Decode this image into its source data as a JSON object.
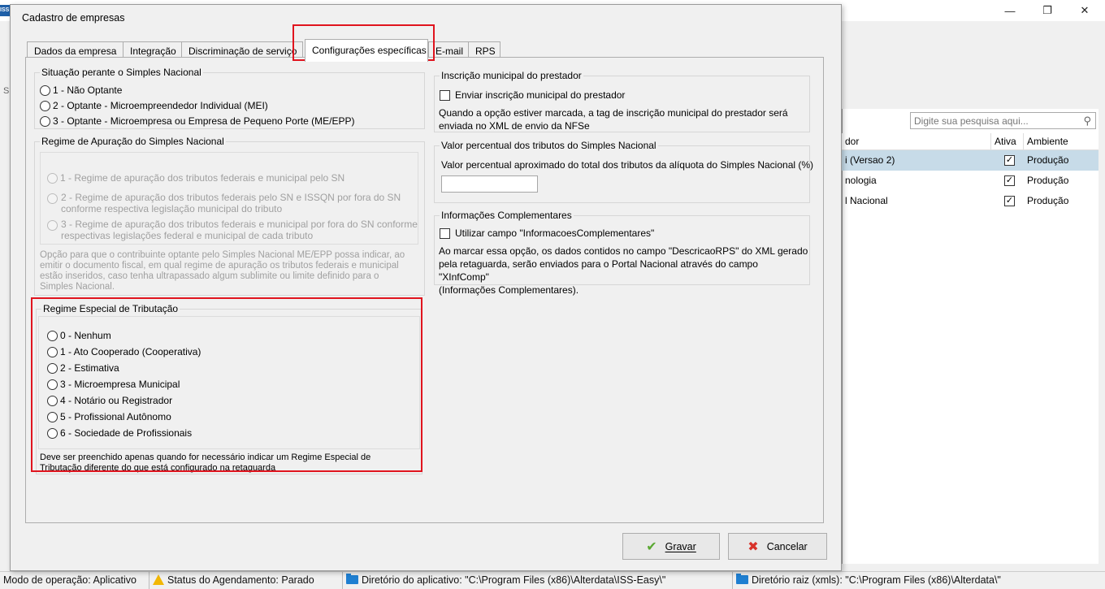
{
  "background": {
    "search_placeholder": "Digite sua pesquisa aqui...",
    "columns": [
      "dor",
      "Ativa",
      "Ambiente"
    ],
    "rows": [
      {
        "name": "i (Versao 2)",
        "ambiente": "Produção",
        "selected": true
      },
      {
        "name": "nologia",
        "ambiente": "Produção",
        "selected": false
      },
      {
        "name": "l Nacional",
        "ambiente": "Produção",
        "selected": false
      }
    ],
    "left_stub": "S"
  },
  "status_bar": {
    "mode": "Modo de operação: Aplicativo",
    "schedule": "Status do Agendamento: Parado",
    "app_dir": "Diretório do aplicativo: \"C:\\Program Files (x86)\\Alterdata\\ISS-Easy\\\"",
    "root_dir": "Diretório raiz (xmls): \"C:\\Program Files (x86)\\Alterdata\\\""
  },
  "dialog": {
    "title": "Cadastro de empresas",
    "tabs": [
      "Dados da empresa",
      "Integração",
      "Discriminação de serviço",
      "Configurações específicas",
      "E-mail",
      "RPS"
    ],
    "active_tab": "Configurações específicas",
    "simples": {
      "title": "Situação perante o Simples Nacional",
      "options": [
        "1 - Não Optante",
        "2 - Optante - Microempreendedor Individual (MEI)",
        "3 - Optante - Microempresa ou Empresa de Pequeno Porte (ME/EPP)"
      ]
    },
    "regime_apuracao": {
      "title": "Regime de Apuração do Simples Nacional",
      "opt1": "1 - Regime de apuração dos tributos federais e municipal pelo SN",
      "opt2_l1": "2 - Regime de apuração dos tributos federais pelo SN e ISSQN por fora do SN",
      "opt2_l2": "conforme respectiva legislação municipal do tributo",
      "opt3_l1": "3 - Regime de apuração dos tributos federais e municipal por fora do SN conforme",
      "opt3_l2": "respectivas legislações federal e municipal de cada tributo",
      "note_l1": "Opção para que o contribuinte optante pelo Simples Nacional ME/EPP possa indicar, ao",
      "note_l2": "emitir o documento fiscal, em qual regime de apuração os tributos federais e municipal",
      "note_l3": "estão inseridos, caso tenha ultrapassado algum sublimite ou limite definido para o",
      "note_l4": "Simples Nacional."
    },
    "regime_especial": {
      "title": "Regime Especial de Tributação",
      "options": [
        "0 - Nenhum",
        "1 - Ato Cooperado (Cooperativa)",
        "2 - Estimativa",
        "3 - Microempresa Municipal",
        "4 - Notário ou Registrador",
        "5 - Profissional Autônomo",
        "6 - Sociedade de Profissionais"
      ],
      "note_l1": "Deve ser preenchido apenas quando for necessário indicar um Regime Especial de",
      "note_l2": "Tributação diferente do que está configurado na retaguarda"
    },
    "inscricao": {
      "title": "Inscrição municipal do prestador",
      "checkbox": "Enviar inscrição municipal do prestador",
      "desc_l1": "Quando a opção estiver marcada, a tag de inscrição municipal do prestador será",
      "desc_l2": "enviada no XML de envio da NFSe"
    },
    "valor_percentual": {
      "title": "Valor percentual dos tributos do Simples Nacional",
      "label": "Valor percentual aproximado do total dos tributos da alíquota do Simples Nacional (%)",
      "value": ""
    },
    "info_complementares": {
      "title": "Informações Complementares",
      "checkbox": "Utilizar campo \"InformacoesComplementares\"",
      "desc_l1": "Ao marcar essa opção, os dados contidos no campo \"DescricaoRPS\" do XML gerado",
      "desc_l2": "pela retaguarda, serão enviados para o Portal Nacional através do campo \"XInfComp\"",
      "desc_l3": "(Informações Complementares)."
    },
    "buttons": {
      "save": "Gravar",
      "cancel": "Cancelar"
    }
  }
}
